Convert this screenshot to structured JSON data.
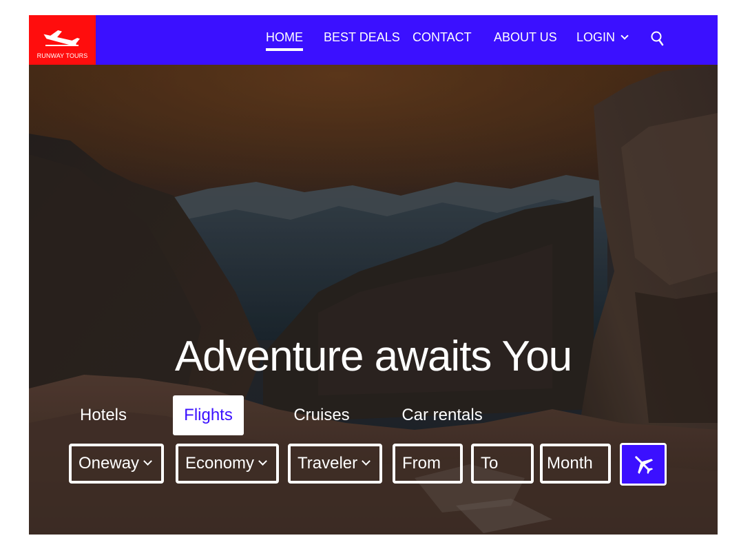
{
  "brand": {
    "name": "RUNWAY TOURS",
    "logo_icon": "airplane-takeoff-icon",
    "logo_color": "#ff0d0d"
  },
  "nav": {
    "background": "#3b10ff",
    "items": [
      {
        "label": "HOME",
        "active": true
      },
      {
        "label": "BEST DEALS",
        "active": false
      },
      {
        "label": "CONTACT",
        "active": false
      },
      {
        "label": "ABOUT US",
        "active": false
      },
      {
        "label": "LOGIN",
        "active": false,
        "has_dropdown": true
      }
    ],
    "search_icon": "search-icon"
  },
  "hero": {
    "headline": "Adventure awaits You",
    "image": "canyon-landscape"
  },
  "tabs": [
    {
      "label": "Hotels",
      "active": false
    },
    {
      "label": "Flights",
      "active": true
    },
    {
      "label": "Cruises",
      "active": false
    },
    {
      "label": "Car rentals",
      "active": false
    }
  ],
  "search_form": {
    "trip_type": "Oneway",
    "cabin_class": "Economy",
    "travelers": "Traveler",
    "from_placeholder": "From",
    "to_placeholder": "To",
    "month_placeholder": "Month",
    "submit_icon": "airplane-icon"
  }
}
